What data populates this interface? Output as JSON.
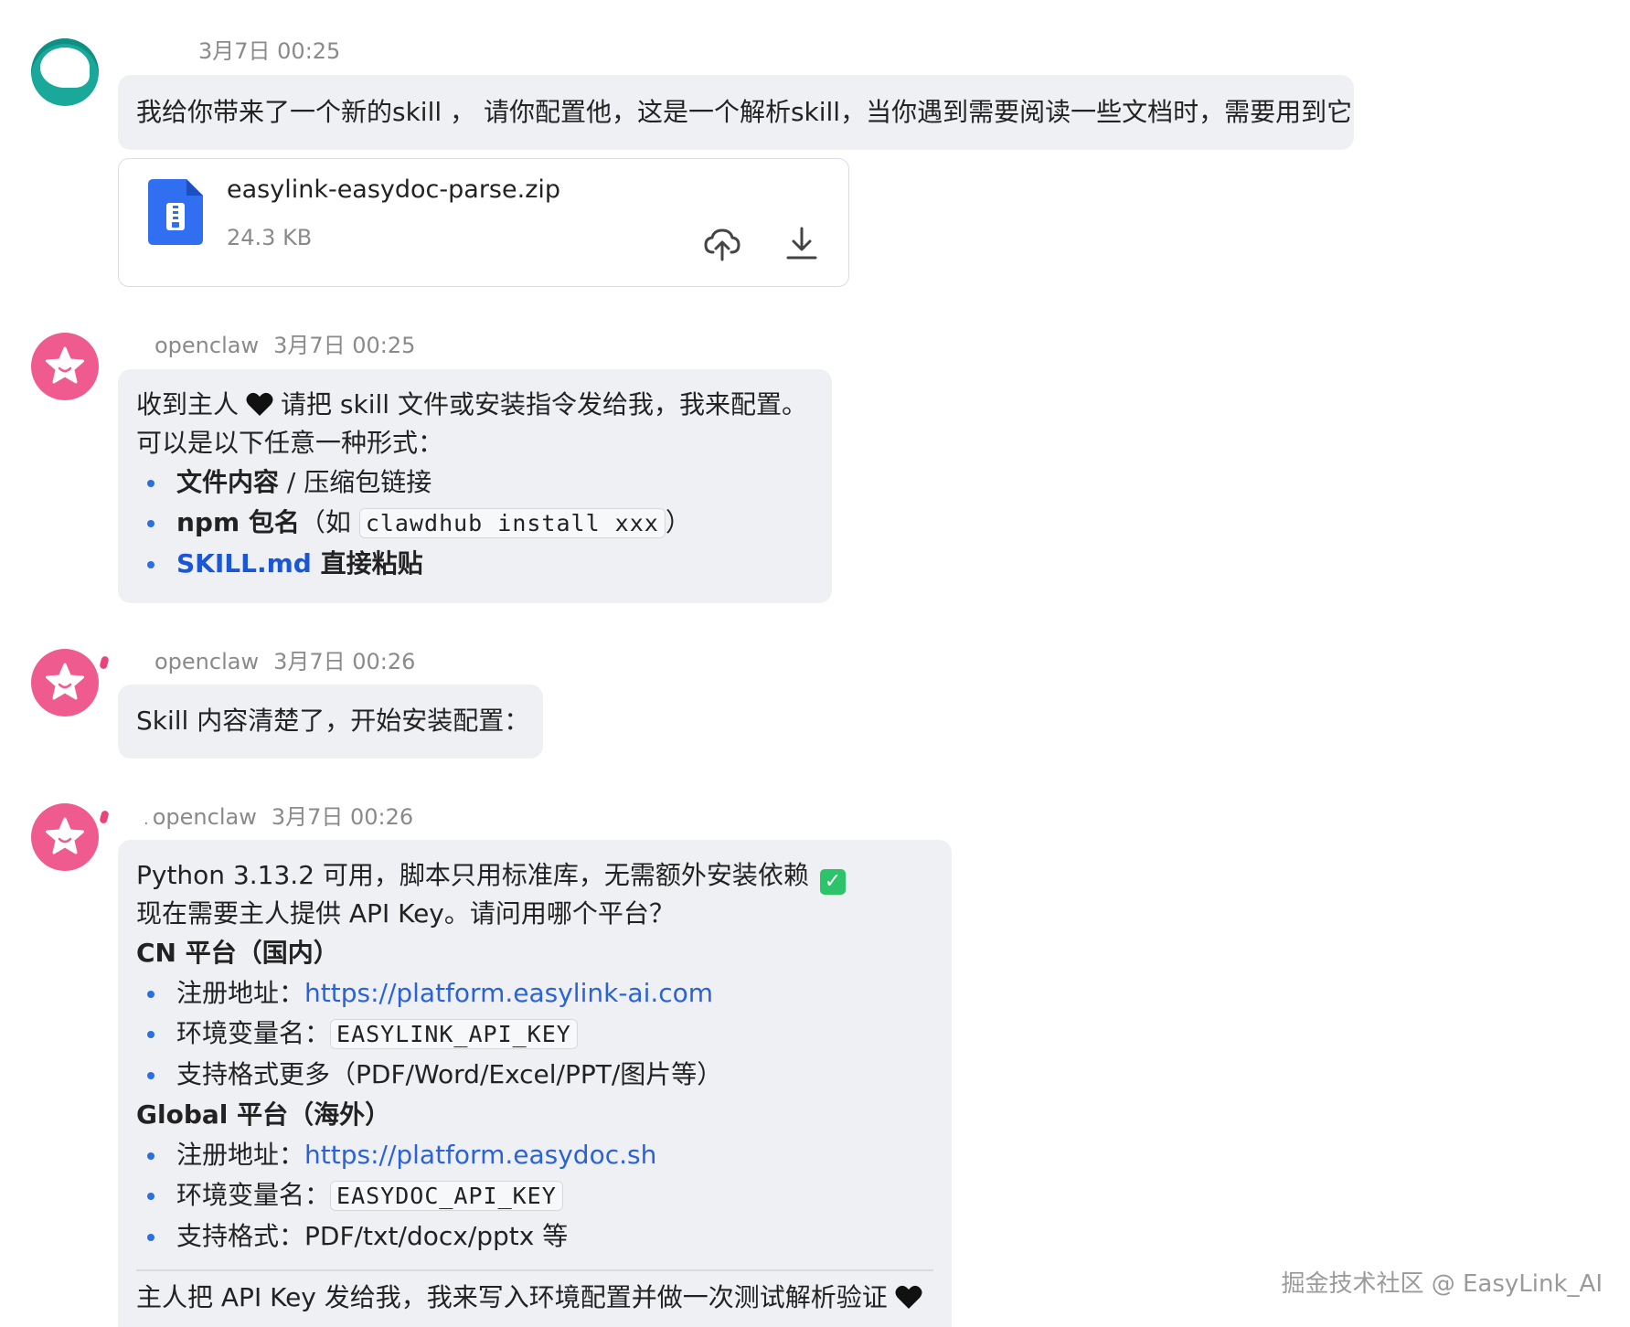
{
  "messages": [
    {
      "time": "3月7日 00:25",
      "text": "我给你带来了一个新的skill ， 请你配置他，这是一个解析skill，当你遇到需要阅读一些文档时，需要用到它",
      "attachment": {
        "file_name": "easylink-easydoc-parse.zip",
        "file_size": "24.3 KB"
      }
    },
    {
      "sender": "openclaw",
      "time": "3月7日 00:25",
      "line1_a": "收到主人",
      "line1_b": "请把 skill 文件或安装指令发给我，我来配置。",
      "line2": "可以是以下任意一种形式：",
      "items": [
        {
          "strong": "文件内容",
          "rest": " / 压缩包链接"
        },
        {
          "strong": "npm 包名",
          "rest_a": "（如 ",
          "code": "clawdhub install xxx",
          "rest_b": "）"
        },
        {
          "blue_strong": "SKILL.md",
          "strong": " 直接粘贴"
        }
      ]
    },
    {
      "sender": "openclaw",
      "time": "3月7日 00:26",
      "text": "Skill 内容清楚了，开始安装配置："
    },
    {
      "prefix": ".",
      "sender": "openclaw",
      "time": "3月7日 00:26",
      "line1": "Python 3.13.2 可用，脚本只用标准库，无需额外安装依赖",
      "line2": "现在需要主人提供 API Key。请问用哪个平台？",
      "cn": {
        "heading": "CN 平台（国内）",
        "register_label": "注册地址：",
        "register_url": "https://platform.easylink-ai.com",
        "env_label": "环境变量名：",
        "env_name": "EASYLINK_API_KEY",
        "formats": "支持格式更多（PDF/Word/Excel/PPT/图片等）"
      },
      "global": {
        "heading": "Global 平台（海外）",
        "register_label": "注册地址：",
        "register_url": "https://platform.easydoc.sh",
        "env_label": "环境变量名：",
        "env_name": "EASYDOC_API_KEY",
        "formats": "支持格式：PDF/txt/docx/pptx 等"
      },
      "footer": "主人把 API Key 发给我，我来写入环境配置并做一次测试解析验证"
    }
  ],
  "watermark": "掘金技术社区 @ EasyLink_AI",
  "colors": {
    "bubble": "#eef0f3",
    "link": "#2b62d9",
    "bullet": "#2b6fe0",
    "bot_avatar": "#ef5b8e",
    "user_avatar": "#1aa89a",
    "check": "#2cc36b"
  }
}
